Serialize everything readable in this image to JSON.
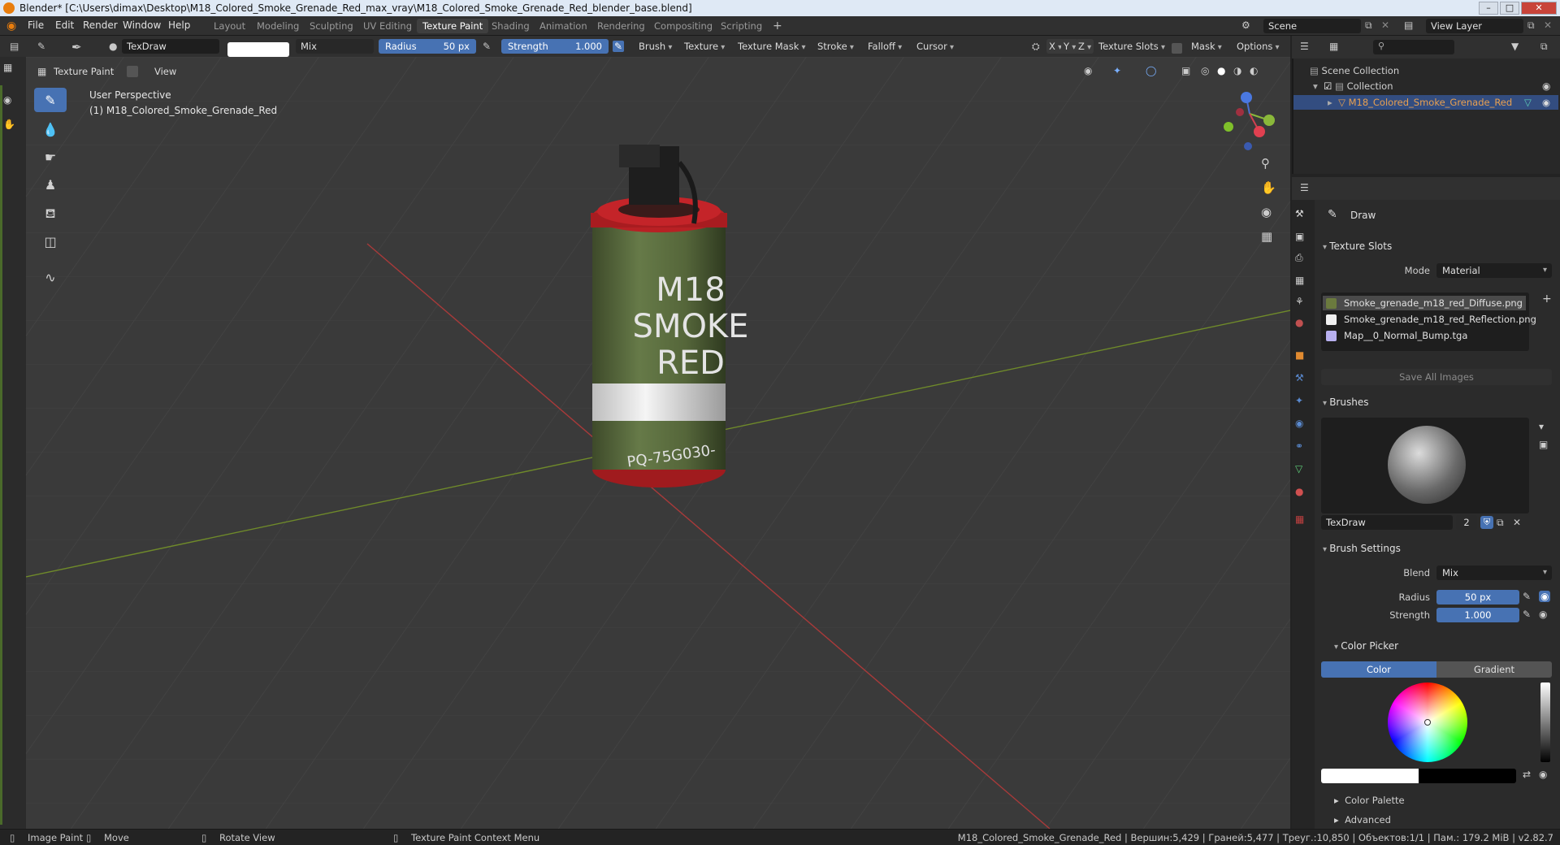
{
  "window": {
    "title": "Blender* [C:\\Users\\dimax\\Desktop\\M18_Colored_Smoke_Grenade_Red_max_vray\\M18_Colored_Smoke_Grenade_Red_blender_base.blend]"
  },
  "menu": [
    "File",
    "Edit",
    "Render",
    "Window",
    "Help"
  ],
  "workspaces": [
    "Layout",
    "Modeling",
    "Sculpting",
    "UV Editing",
    "Texture Paint",
    "Shading",
    "Animation",
    "Rendering",
    "Compositing",
    "Scripting"
  ],
  "active_workspace": "Texture Paint",
  "scene": {
    "label": "Scene",
    "view_layer": "View Layer"
  },
  "tool_header": {
    "brush_name": "TexDraw",
    "blend": "Mix",
    "radius_label": "Radius",
    "radius_value": "50 px",
    "strength_label": "Strength",
    "strength_value": "1.000",
    "dropdowns": [
      "Brush",
      "Texture",
      "Texture Mask",
      "Stroke",
      "Falloff",
      "Cursor"
    ],
    "axes": [
      "X",
      "Y",
      "Z"
    ],
    "texture_slots": "Texture Slots",
    "mask": "Mask",
    "options": "Options"
  },
  "header2": {
    "mode": "Texture Paint",
    "view": "View"
  },
  "viewport": {
    "perspective": "User Perspective",
    "object": "(1) M18_Colored_Smoke_Grenade_Red",
    "grenade_text": [
      "M18",
      "SMOKE",
      "RED"
    ],
    "grenade_code": "PQ-75G030-"
  },
  "outliner": {
    "scene_collection": "Scene Collection",
    "collection": "Collection",
    "object": "M18_Colored_Smoke_Grenade_Red"
  },
  "properties": {
    "tool_name": "Draw",
    "texture_slots": {
      "title": "Texture Slots",
      "mode_label": "Mode",
      "mode_value": "Material",
      "items": [
        {
          "name": "Smoke_grenade_m18_red_Diffuse.png",
          "color": "#6b7a3e"
        },
        {
          "name": "Smoke_grenade_m18_red_Reflection.png",
          "color": "#f0f0f0"
        },
        {
          "name": "Map__0_Normal_Bump.tga",
          "color": "#b8b0f0"
        }
      ],
      "save_all": "Save All Images"
    },
    "brushes": {
      "title": "Brushes",
      "brush_name": "TexDraw",
      "users": "2"
    },
    "brush_settings": {
      "title": "Brush Settings",
      "blend_label": "Blend",
      "blend_value": "Mix",
      "radius_label": "Radius",
      "radius_value": "50 px",
      "strength_label": "Strength",
      "strength_value": "1.000"
    },
    "color_picker": {
      "title": "Color Picker",
      "tab_color": "Color",
      "tab_gradient": "Gradient"
    },
    "color_palette": "Color Palette",
    "advanced": "Advanced"
  },
  "statusbar": {
    "image_paint": "Image Paint",
    "move": "Move",
    "rotate": "Rotate View",
    "context": "Texture Paint Context Menu",
    "stats": "M18_Colored_Smoke_Grenade_Red | Вершин:5,429 | Граней:5,477 | Треуг.:10,850 | Объектов:1/1 | Пам.: 179.2 MiB | v2.82.7"
  },
  "colors": {
    "accent": "#4772b3",
    "grenade_body": "#5a6b3e",
    "grenade_cap": "#b82024"
  }
}
